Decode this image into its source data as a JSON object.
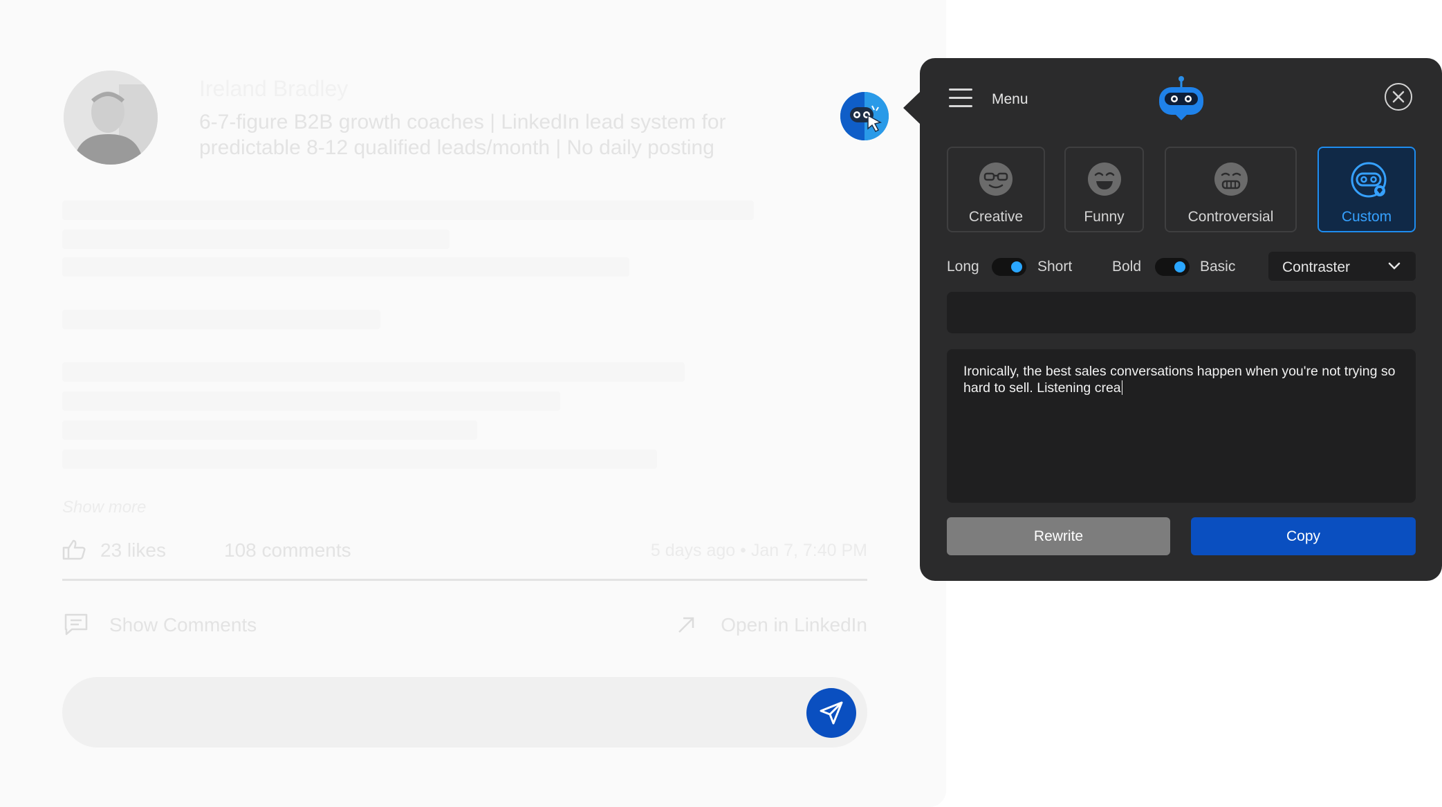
{
  "post": {
    "author_name": "Ireland Bradley",
    "headline": "6-7-figure B2B growth coaches | LinkedIn lead system for predictable 8-12 qualified leads/month | No daily posting",
    "show_more": "Show more",
    "likes": "23 likes",
    "comments": "108 comments",
    "time": "5 days ago • Jan 7, 7:40 PM",
    "show_comments": "Show Comments",
    "open_in_linkedin": "Open in LinkedIn",
    "reply_placeholder": ""
  },
  "panel": {
    "menu_label": "Menu",
    "modes": [
      {
        "label": "Creative",
        "icon": "glasses-face-icon",
        "active": false
      },
      {
        "label": "Funny",
        "icon": "laughing-face-icon",
        "active": false
      },
      {
        "label": "Controversial",
        "icon": "grimace-face-icon",
        "active": false
      },
      {
        "label": "Custom",
        "icon": "robot-face-icon",
        "active": true
      }
    ],
    "toggles": {
      "length_left": "Long",
      "length_right": "Short",
      "tone_left": "Bold",
      "tone_right": "Basic"
    },
    "style_select": {
      "value": "Contraster"
    },
    "instruction_input": {
      "value": "",
      "placeholder": ""
    },
    "output_text": "Ironically, the best sales conversations happen when you're not trying so hard to sell. Listening crea",
    "rewrite_label": "Rewrite",
    "copy_label": "Copy"
  },
  "colors": {
    "panel_bg": "#2b2b2c",
    "accent_blue": "#0a4fc0",
    "active_card_border": "#1e8df0",
    "toggle_knob": "#2aa6ff"
  }
}
